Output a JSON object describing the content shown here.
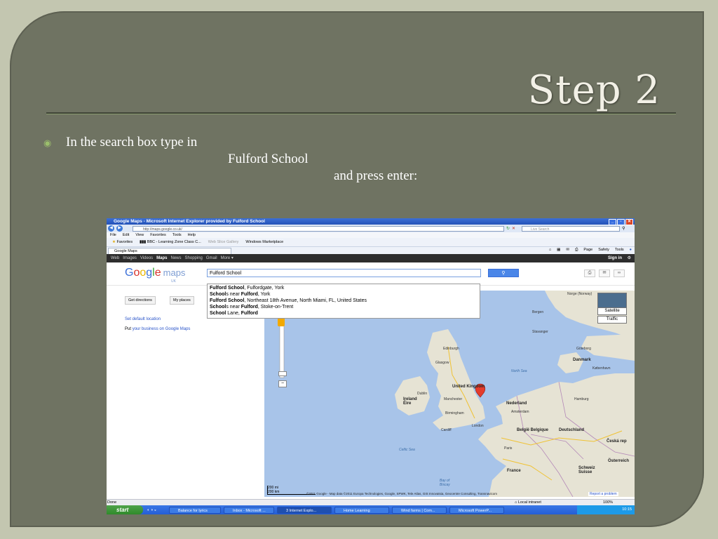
{
  "slide": {
    "title": "Step 2",
    "line1": "In the search box type in",
    "line2": "Fulford School",
    "line3": "and press enter:"
  },
  "browser": {
    "title": "Google Maps - Microsoft Internet Explorer provided by Fulford School",
    "address": "http://maps.google.co.uk/",
    "live_search_placeholder": "Live Search",
    "menu": [
      "File",
      "Edit",
      "View",
      "Favorites",
      "Tools",
      "Help"
    ],
    "favorites": [
      "Favorites",
      "BBC - Learning Zone Class C...",
      "Web Slice Gallery",
      "Windows Marketplace"
    ],
    "tab": "Google Maps",
    "toolbar": [
      "Page",
      "Safety",
      "Tools"
    ],
    "status": "Done",
    "zone": "Local intranet",
    "zoom": "100%"
  },
  "google_bar": {
    "links": [
      "Web",
      "Images",
      "Videos",
      "Maps",
      "News",
      "Shopping",
      "Gmail",
      "More"
    ],
    "active": "Maps",
    "sign_in": "Sign in"
  },
  "maps": {
    "logo_word": "Google",
    "product": "maps",
    "region": "UK",
    "search_value": "Fulford School",
    "search_button": "Search",
    "buttons": [
      "Get directions",
      "My places"
    ],
    "set_default": "Set default location",
    "put_prefix": "Put",
    "put_link": "your business on Google Maps",
    "suggestions": [
      {
        "bold1": "Fulford School",
        "rest": ", Fulfordgate, York"
      },
      {
        "bold1": "School",
        "mid": "s near ",
        "bold2": "Fulford",
        "rest": ", York"
      },
      {
        "bold1": "Fulford School",
        "rest": ", Northeast 18th Avenue, North Miami, FL, United States"
      },
      {
        "bold1": "School",
        "mid": "s near ",
        "bold2": "Fulford",
        "rest": ", Stoke-on-Trent"
      },
      {
        "bold1": "School",
        "mid": " Lane, ",
        "bold2": "Fulford",
        "rest": ""
      }
    ],
    "map_types": [
      "Satellite",
      "Traffic"
    ],
    "scale": "200 mi",
    "scale_bottom": "200 km",
    "copyright": "©2011 Google - Map data ©2011 Europa Technologies, Google, SPWK, Tele Atlas, GIS Innovatsia, Geocentre Consulting, Transnavicom",
    "report": "Report a problem",
    "labels": {
      "north_sea": "North Sea",
      "celtic_sea": "Celtic Sea",
      "bay_of_biscay": "Bay of Biscay",
      "uk": "United Kingdom",
      "ireland": "Ireland Éire",
      "france": "France",
      "norge": "Norge (Norway)",
      "danmark": "Danmark",
      "belgium": "België Belgique",
      "nederland": "Nederland",
      "deutschland": "Deutschland",
      "czech": "Česká rep",
      "schweiz": "Schweiz Suisse",
      "osterreich": "Österreich",
      "london": "London",
      "dublin": "Dublin",
      "paris": "Paris",
      "edinburgh": "Edinburgh",
      "glasgow": "Glasgow",
      "manchester": "Manchester",
      "birmingham": "Birmingham",
      "cardiff": "Cardiff",
      "hamburg": "Hamburg",
      "bergen": "Bergen",
      "stavanger": "Stavanger",
      "goteborg": "Göteborg",
      "kobenhavn": "København",
      "amsterdam": "Amsterdam"
    }
  },
  "taskbar": {
    "start": "start",
    "items": [
      "Balance for lyrics",
      "Inbox - Microsoft ...",
      "3 Internet Explo...",
      "Home Learning",
      "Wind farms | Com...",
      "Microsoft PowerP..."
    ],
    "clock": "10:15"
  }
}
